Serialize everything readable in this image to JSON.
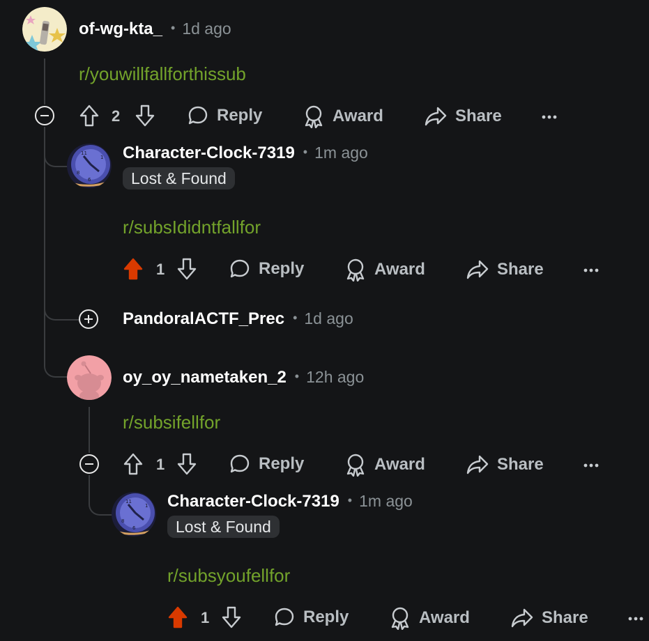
{
  "actions": {
    "reply": "Reply",
    "award": "Award",
    "share": "Share"
  },
  "comment1": {
    "username": "of-wg-kta_",
    "time": "1d ago",
    "body": "r/youwillfallforthissub",
    "score": "2"
  },
  "comment2": {
    "username": "Character-Clock-7319",
    "time": "1m ago",
    "flair": "Lost & Found",
    "body": "r/subsIdidntfallfor",
    "score": "1",
    "upvoted": true
  },
  "comment3": {
    "username": "PandoralACTF_Prec",
    "time": "1d ago",
    "collapsed": true
  },
  "comment4": {
    "username": "oy_oy_nametaken_2",
    "time": "12h ago",
    "body": "r/subsifellfor",
    "score": "1"
  },
  "comment5": {
    "username": "Character-Clock-7319",
    "time": "1m ago",
    "flair": "Lost & Found",
    "body": "r/subsyoufellfor",
    "score": "1",
    "upvoted": true
  },
  "colors": {
    "background": "#141517",
    "link": "#73a32b",
    "upvote": "#d93a00",
    "thread_line": "#3a3c3f"
  },
  "icons": [
    "upvote-icon",
    "downvote-icon",
    "reply-icon",
    "award-icon",
    "share-icon",
    "more-icon",
    "collapse-icon",
    "expand-icon"
  ]
}
